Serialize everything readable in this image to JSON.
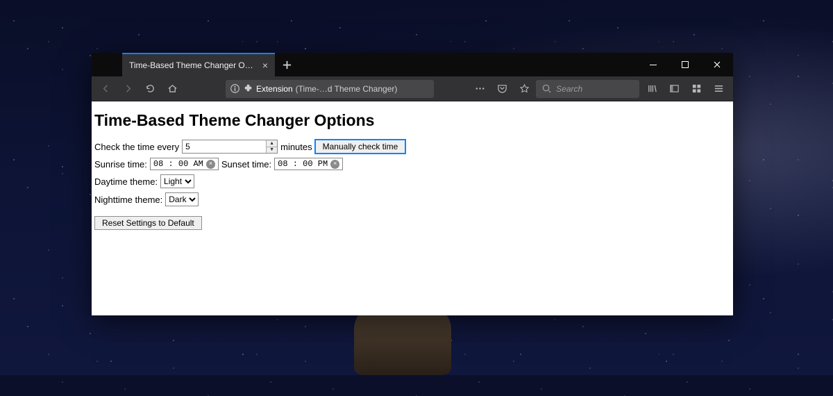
{
  "browser": {
    "tab_title": "Time-Based Theme Changer Options",
    "url_label_prefix": "Extension",
    "url_label": "(Time-…d Theme Changer)",
    "search_placeholder": "Search"
  },
  "page": {
    "heading": "Time-Based Theme Changer Options",
    "check_prefix": "Check the time every",
    "check_value": "5",
    "check_suffix": "minutes",
    "manual_btn": "Manually check time",
    "sunrise_label": "Sunrise time:",
    "sunrise_value": "08 : 00   AM",
    "sunset_label": "Sunset time:",
    "sunset_value": "08 : 00   PM",
    "daytime_label": "Daytime theme:",
    "daytime_value": "Light",
    "nighttime_label": "Nighttime theme:",
    "nighttime_value": "Dark",
    "reset_btn": "Reset Settings to Default"
  }
}
